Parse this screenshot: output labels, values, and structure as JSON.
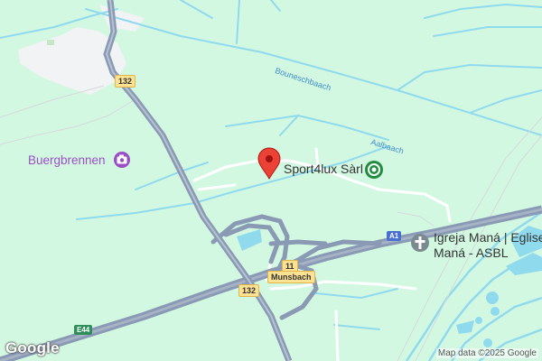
{
  "map": {
    "places": {
      "burgbrennen": "Buergbrennen",
      "sport4lux": "Sport4lux Sàrl",
      "church_line1": "Igreja Maná | Eglise",
      "church_line2": "Maná - ASBL"
    },
    "waterways": {
      "bouneschbaach": "Bouneschbaach",
      "aalbaach": "Aalbaach"
    },
    "road_shields": {
      "r132_top": "132",
      "r132_bottom": "132",
      "a1": "A1",
      "r11": "11",
      "munsbach": "Munsbach",
      "e44": "E44"
    },
    "logo": "Google",
    "attribution": "Map data ©2025 Google",
    "colors": {
      "land": "#d3f8e2",
      "water": "#90daee",
      "motorway": "#8a9ab4",
      "road": "#ffffff",
      "marker": "#ea4335",
      "poi_purple": "#9a4fc4",
      "poi_green": "#1e8e3e",
      "poi_gray": "#7b8a8f"
    },
    "icons": {
      "pin": "map-pin-marker",
      "camera": "camera-icon",
      "sport": "sport-poi-icon",
      "church": "church-cross-icon"
    }
  }
}
